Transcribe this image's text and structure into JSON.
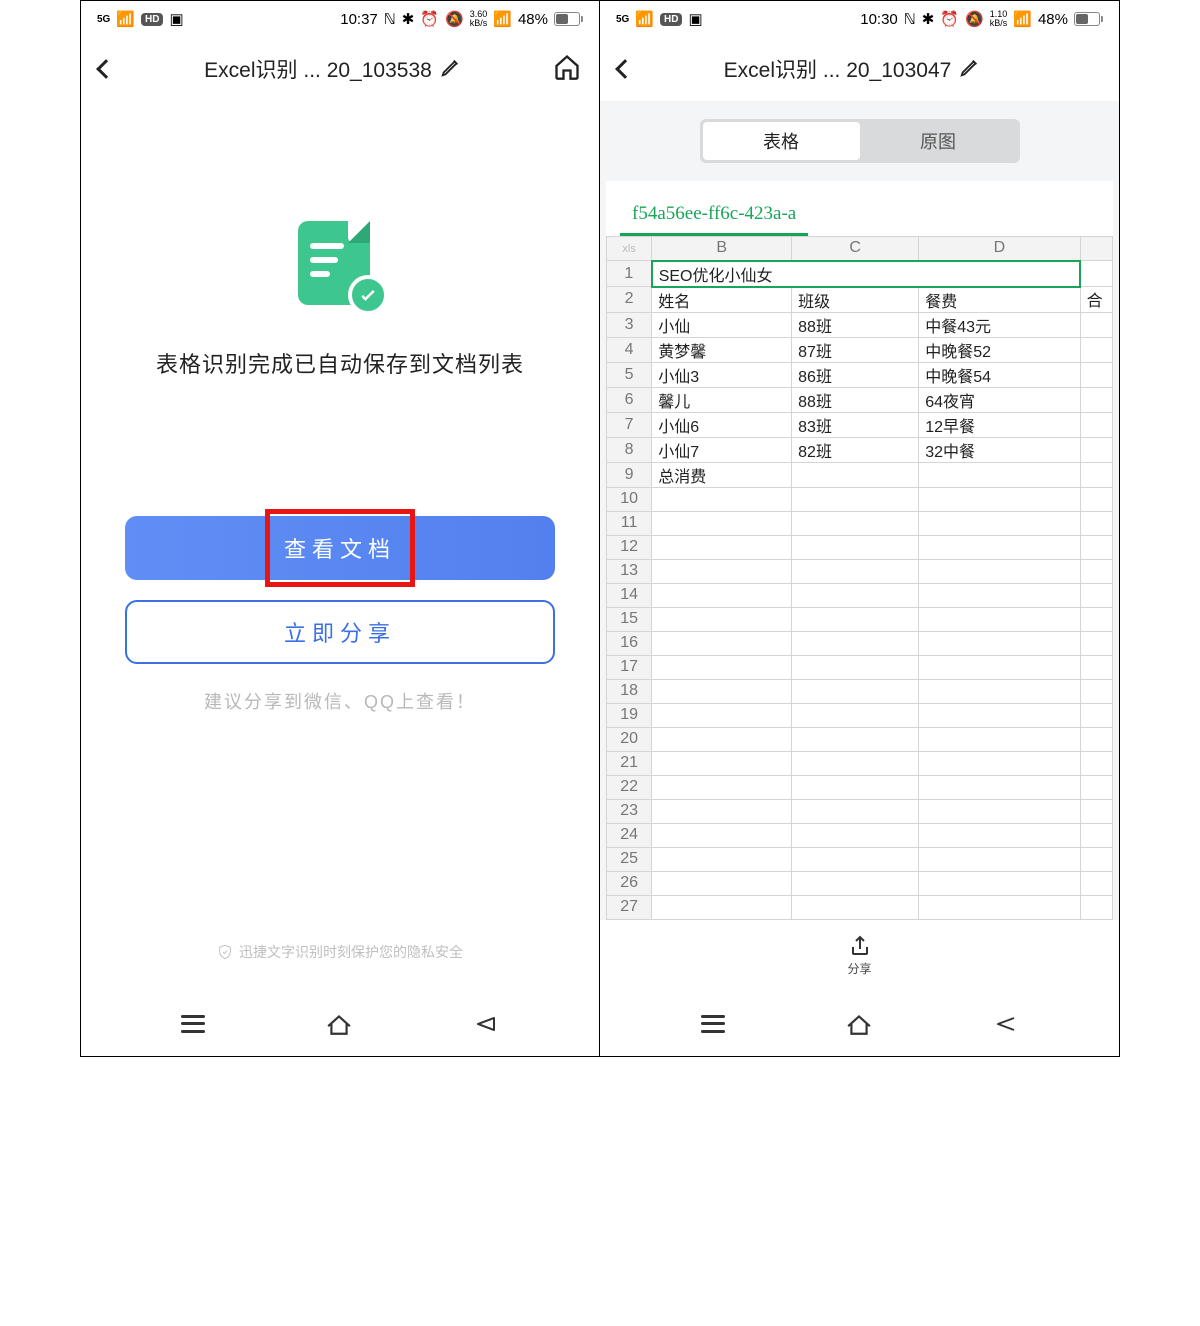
{
  "screen1": {
    "status": {
      "time": "10:37",
      "net_speed": "3.60",
      "net_unit": "kB/s",
      "battery_pct": "48%",
      "sig": "5G",
      "hd": "HD"
    },
    "header": {
      "title": "Excel识别 ... 20_103538"
    },
    "success_msg": "表格识别完成已自动保存到文档列表",
    "btn_primary": "查看文档",
    "btn_outline": "立即分享",
    "tip": "建议分享到微信、QQ上查看！",
    "privacy": "迅捷文字识别时刻保护您的隐私安全"
  },
  "screen2": {
    "status": {
      "time": "10:30",
      "net_speed": "1.10",
      "net_unit": "kB/s",
      "battery_pct": "48%",
      "sig": "5G",
      "hd": "HD"
    },
    "header": {
      "title": "Excel识别 ... 20_103047"
    },
    "tabs": {
      "table": "表格",
      "image": "原图"
    },
    "sheet_tab": "f54a56ee-ff6c-423a-a",
    "columns": [
      "B",
      "C",
      "D"
    ],
    "col_extra": "合",
    "corner": "xls",
    "rows": [
      {
        "n": "1",
        "b": "SEO优化小仙女",
        "c": "",
        "d": "",
        "merged": true
      },
      {
        "n": "2",
        "b": "姓名",
        "c": "班级",
        "d": "餐费"
      },
      {
        "n": "3",
        "b": "小仙",
        "c": "88班",
        "d": "中餐43元"
      },
      {
        "n": "4",
        "b": "黄梦馨",
        "c": "87班",
        "d": "中晚餐52"
      },
      {
        "n": "5",
        "b": "小仙3",
        "c": "86班",
        "d": "中晚餐54"
      },
      {
        "n": "6",
        "b": "馨儿",
        "c": "88班",
        "d": "64夜宵"
      },
      {
        "n": "7",
        "b": "小仙6",
        "c": "83班",
        "d": "12早餐"
      },
      {
        "n": "8",
        "b": "小仙7",
        "c": "82班",
        "d": "32中餐"
      },
      {
        "n": "9",
        "b": "总消费",
        "c": "",
        "d": ""
      }
    ],
    "empty_rows": [
      "10",
      "11",
      "12",
      "13",
      "14",
      "15",
      "16",
      "17",
      "18",
      "19",
      "20",
      "21",
      "22",
      "23",
      "24",
      "25",
      "26",
      "27"
    ],
    "share_label": "分享"
  }
}
